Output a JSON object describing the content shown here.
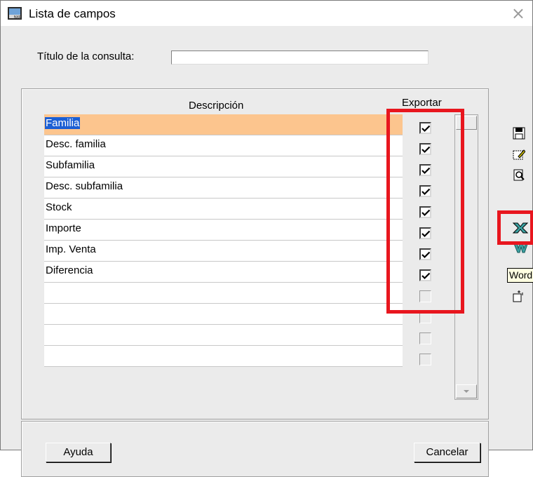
{
  "window": {
    "title": "Lista de campos",
    "close_glyph": "×"
  },
  "query": {
    "label": "Título de la consulta:",
    "value": ""
  },
  "grid": {
    "col_description": "Descripción",
    "col_export": "Exportar",
    "rows": [
      {
        "label": "Familia",
        "export": true,
        "selected": true
      },
      {
        "label": "Desc. familia",
        "export": true
      },
      {
        "label": "Subfamilia",
        "export": true
      },
      {
        "label": "Desc. subfamilia",
        "export": true
      },
      {
        "label": "Stock",
        "export": true
      },
      {
        "label": "Importe",
        "export": true
      },
      {
        "label": "Imp. Venta",
        "export": true
      },
      {
        "label": "Diferencia",
        "export": true
      },
      {
        "label": "",
        "export": false
      },
      {
        "label": "",
        "export": false
      },
      {
        "label": "",
        "export": false
      },
      {
        "label": "",
        "export": false
      }
    ]
  },
  "toolbar": {
    "icons": [
      "save-icon",
      "edit-icon",
      "print-preview-icon",
      "excel-icon",
      "word-icon",
      "new-window-icon"
    ],
    "tooltip": "Word"
  },
  "buttons": {
    "help": "Ayuda",
    "cancel": "Cancelar"
  },
  "colors": {
    "selection": "#fcc58e",
    "highlight": "#1c5fd4",
    "annotation": "#e8161e"
  }
}
